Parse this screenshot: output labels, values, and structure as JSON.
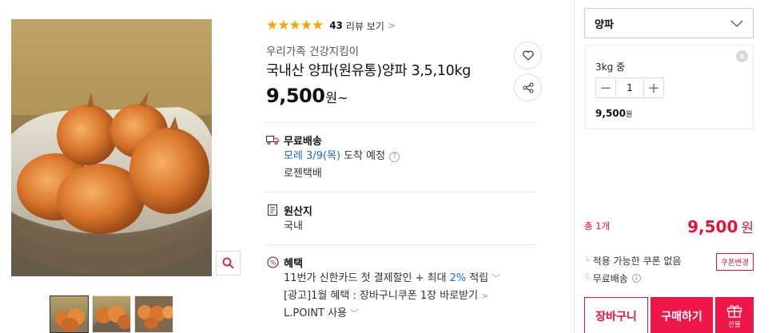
{
  "gallery": {
    "main_image_alt": "onions-in-basket-photo",
    "zoom_icon": "magnifier-icon",
    "thumbnails": [
      {
        "name": "thumbnail-1",
        "active": true
      },
      {
        "name": "thumbnail-2",
        "active": false
      },
      {
        "name": "thumbnail-3",
        "active": false
      }
    ]
  },
  "rating": {
    "stars": "★★★★★",
    "count": "43",
    "label": "리뷰 보기",
    "arrow": ">"
  },
  "product": {
    "seller": "우리가족 건강지킴이",
    "title": "국내산 양파(원유통)양파 3,5,10kg",
    "price": "9,500",
    "price_unit": "원~"
  },
  "delivery": {
    "label": "무료배송",
    "eta_date": "모레 3/9(목)",
    "eta_suffix": "도착 예정",
    "help_icon": "?",
    "courier": "로젠택배"
  },
  "origin": {
    "label": "원산지",
    "value": "국내"
  },
  "benefits": {
    "label": "혜택",
    "line1_prefix": "11번가 신한카드 첫 결제할인 + 최대",
    "line1_rate": "2%",
    "line1_suffix": "적립",
    "line2": "[광고]1월 혜택 : 장바구니쿠폰 1장 바로받기",
    "line3": "L.POINT 사용",
    "chev_down": "﹀",
    "chev_right": ">"
  },
  "purchase": {
    "option_value": "양파",
    "selected_item": "3kg 중",
    "quantity": "1",
    "minus": "−",
    "plus": "+",
    "item_price": "9,500",
    "item_price_unit": "원",
    "total_count": "총 1개",
    "total_price": "9,500",
    "total_unit": "원",
    "coupon_text": "적용 가능한 쿠폰 없음",
    "coupon_button": "쿠폰변경",
    "shipping_text": "무료배송",
    "cart_button": "장바구니",
    "buy_button": "구매하기",
    "gift_button": "선물"
  },
  "colors": {
    "accent": "#f1164a",
    "accent_text": "#e1153a",
    "link_blue": "#1769d1",
    "star": "#f5a500"
  }
}
